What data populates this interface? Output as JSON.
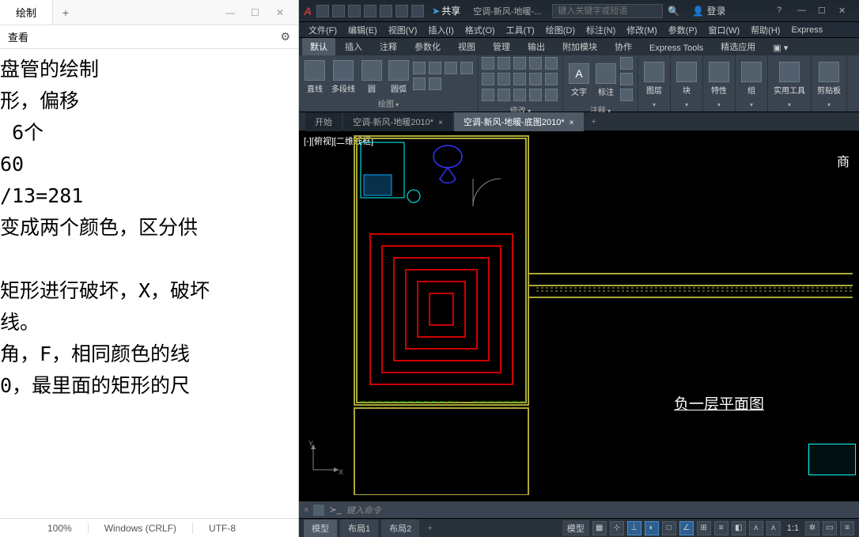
{
  "notepad": {
    "tab_title": "绘制",
    "view_menu": "查看",
    "content": "盘管的绘制\n形，偏移\n 6个\n60\n/13=281\n变成两个颜色，区分供\n\n矩形进行破坏，X，破坏\n线。\n角，F，相同颜色的线\n0，最里面的矩形的尺",
    "status_zoom": "100%",
    "status_eol": "Windows (CRLF)",
    "status_encoding": "UTF-8"
  },
  "autocad": {
    "share_label": "共享",
    "doc_title_short": "空调-新风-地暖-...",
    "search_placeholder": "键入关键字或短语",
    "login_label": "登录",
    "menus": [
      "文件(F)",
      "编辑(E)",
      "视图(V)",
      "插入(I)",
      "格式(O)",
      "工具(T)",
      "绘图(D)",
      "标注(N)",
      "修改(M)",
      "参数(P)",
      "窗口(W)",
      "帮助(H)",
      "Express"
    ],
    "ribbon_tabs": [
      "默认",
      "插入",
      "注释",
      "参数化",
      "视图",
      "管理",
      "输出",
      "附加模块",
      "协作",
      "Express Tools",
      "精选应用"
    ],
    "active_ribbon_tab": 0,
    "draw_btns": [
      "直线",
      "多段线",
      "圆",
      "圆弧"
    ],
    "panel_labels": {
      "draw": "绘图",
      "modify": "修改",
      "annot": "注释",
      "layer": "图层",
      "block": "块",
      "prop": "特性",
      "group": "组",
      "util": "实用工具",
      "clip": "剪贴板"
    },
    "annot_btn": "文字",
    "annot_btn2": "标注",
    "doc_tabs": [
      {
        "label": "开始",
        "active": false,
        "closable": false
      },
      {
        "label": "空调-新风-地暖2010*",
        "active": false,
        "closable": true
      },
      {
        "label": "空调-新风-地暖-底图2010*",
        "active": true,
        "closable": true
      }
    ],
    "viewport_label": "[-][俯视][二维线框]",
    "drawing_title": "负一层平面图",
    "axis_x": "X",
    "axis_y": "Y",
    "cmd_prompt": "键入命令",
    "layout_tabs": [
      {
        "label": "模型",
        "active": true
      },
      {
        "label": "布局1",
        "active": false
      },
      {
        "label": "布局2",
        "active": false
      }
    ],
    "status_model": "模型",
    "status_scale": "1:1"
  }
}
